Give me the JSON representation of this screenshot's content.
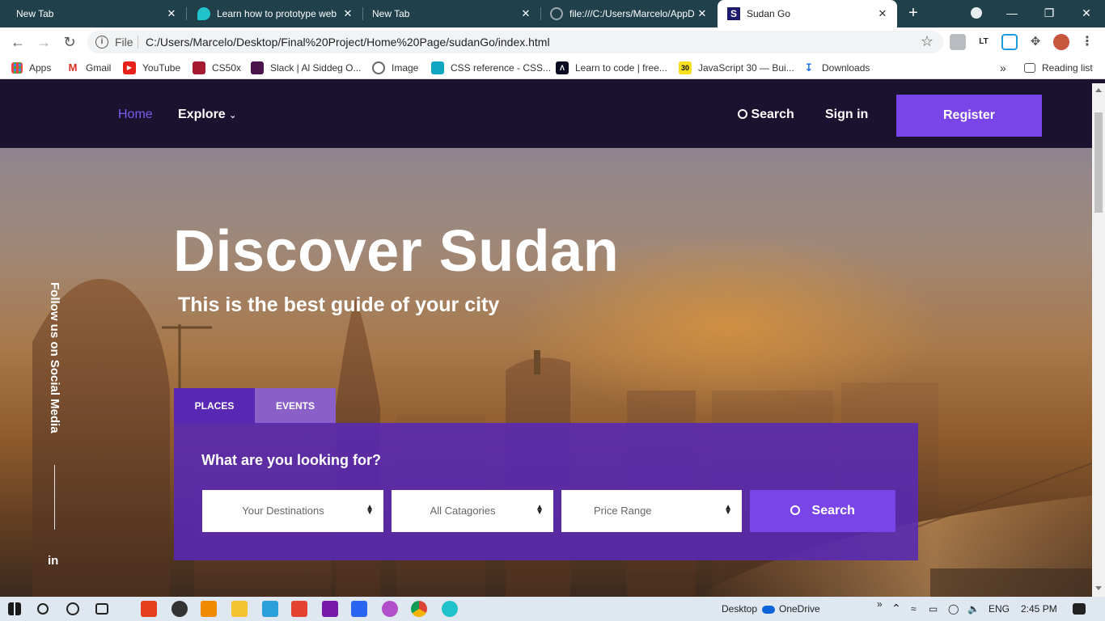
{
  "browser": {
    "tabs": [
      {
        "label": "New Tab",
        "active": false
      },
      {
        "label": "Learn how to prototype web",
        "active": false
      },
      {
        "label": "New Tab",
        "active": false
      },
      {
        "label": "file:///C:/Users/Marcelo/AppD",
        "active": false
      },
      {
        "label": "Sudan Go",
        "active": true
      }
    ],
    "close_glyph": "✕",
    "new_tab_glyph": "+",
    "window_controls": {
      "minimize": "—",
      "restore": "❐",
      "close": "✕"
    },
    "scheme_label": "File",
    "url": "C:/Users/Marcelo/Desktop/Final%20Project/Home%20Page/sudanGo/index.html",
    "bookmarks": [
      {
        "label": "Apps",
        "icon": "apps-grid-icon"
      },
      {
        "label": "Gmail",
        "icon": "gmail-icon"
      },
      {
        "label": "YouTube",
        "icon": "youtube-icon"
      },
      {
        "label": "CS50x",
        "icon": "harvard-icon"
      },
      {
        "label": "Slack | Al Siddeg O...",
        "icon": "slack-icon"
      },
      {
        "label": "Image",
        "icon": "globe-icon"
      },
      {
        "label": "CSS reference - CSS...",
        "icon": "css-icon"
      },
      {
        "label": "Learn to code | free...",
        "icon": "fcc-icon"
      },
      {
        "label": "JavaScript 30 — Bui...",
        "icon": "js30-icon"
      },
      {
        "label": "Downloads",
        "icon": "download-icon"
      }
    ],
    "overflow_glyph": "»",
    "reading_list": "Reading list",
    "extensions": [
      "LT"
    ]
  },
  "site": {
    "nav": {
      "home": "Home",
      "explore": "Explore",
      "search": "Search",
      "sign_in": "Sign in",
      "register": "Register"
    },
    "hero": {
      "title": "Discover Sudan",
      "subtitle": "This is the best guide of your city"
    },
    "social": {
      "follow_text": "Follow us on Social Media",
      "linkedin": "in"
    },
    "search": {
      "tabs": [
        "PLACES",
        "EVENTS"
      ],
      "question": "What are you looking for?",
      "destinations": "Your Destinations",
      "categories": "All Catagories",
      "price": "Price Range",
      "button": "Search"
    },
    "colors": {
      "nav_bg": "#1b1230",
      "accent": "#7a45e8",
      "active_link": "#7b5cf0",
      "panel": "#5828b4"
    }
  },
  "taskbar": {
    "desktop": "Desktop",
    "onedrive": "OneDrive",
    "overflow_glyph": "»",
    "language": "ENG",
    "time": "2:45 PM"
  }
}
